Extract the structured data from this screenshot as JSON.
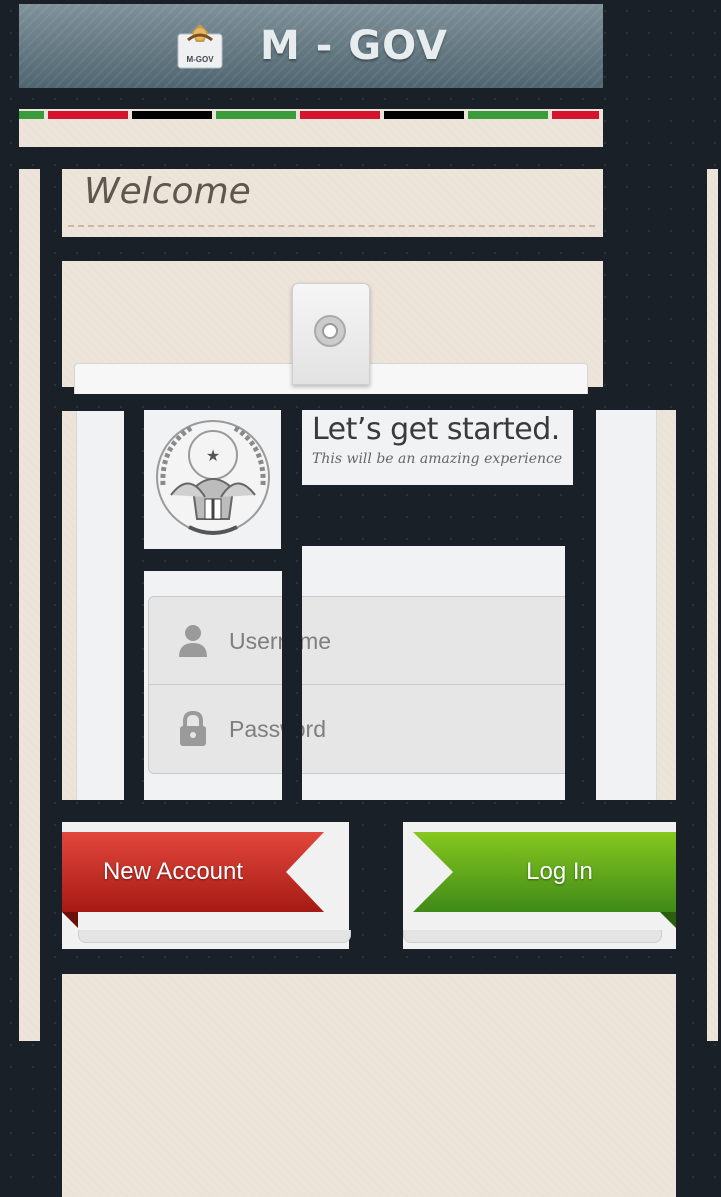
{
  "header": {
    "title": "M - GOV",
    "logo_label": "M-GOV"
  },
  "flag_stripe": {
    "colors": [
      "#3a9b3a",
      "#d4142e",
      "#000000",
      "#3a9b3a",
      "#d4142e",
      "#000000",
      "#3a9b3a",
      "#d4142e"
    ]
  },
  "welcome": {
    "title": "Welcome"
  },
  "intro": {
    "headline": "Let’s get started.",
    "subline": "This will be an amazing experience"
  },
  "login_form": {
    "username_placeholder": "Username",
    "password_placeholder": "Password"
  },
  "actions": {
    "new_account_label": "New Account",
    "login_label": "Log In"
  },
  "colors": {
    "background": "#1a2027",
    "paper": "#ece3d8",
    "new_account": "#c92a22",
    "login": "#5aa824",
    "header": "#5f737c"
  }
}
